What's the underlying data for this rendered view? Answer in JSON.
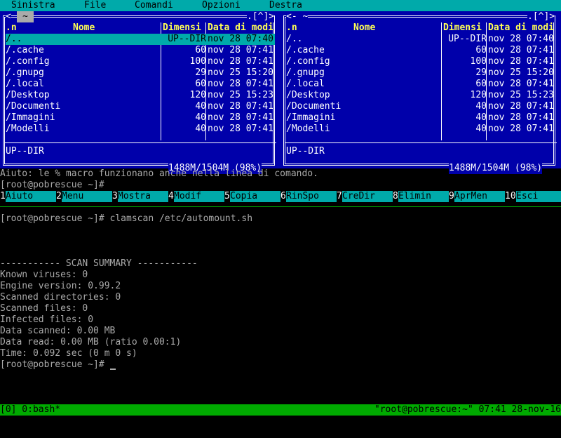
{
  "menubar": {
    "items": [
      "Sinistra",
      "File",
      "Comandi",
      "Opzioni",
      "Destra"
    ]
  },
  "left_panel": {
    "history_btn": "~",
    "caption_left": "<",
    "caption_right": ".[^]>",
    "headers": {
      "name": ".n",
      "name_title": "Nome",
      "size": "Dimensi",
      "date": "Data di modi"
    },
    "rows": [
      {
        "name": "/..",
        "size": "UP--DIR",
        "date": "nov 28 07:40",
        "selected": true
      },
      {
        "name": "/.cache",
        "size": "60",
        "date": "nov 28 07:41"
      },
      {
        "name": "/.config",
        "size": "100",
        "date": "nov 28 07:41"
      },
      {
        "name": "/.gnupg",
        "size": "29",
        "date": "nov 25 15:20"
      },
      {
        "name": "/.local",
        "size": "60",
        "date": "nov 28 07:41"
      },
      {
        "name": "/Desktop",
        "size": "120",
        "date": "nov 25 15:23"
      },
      {
        "name": "/Documenti",
        "size": "40",
        "date": "nov 28 07:41"
      },
      {
        "name": "/Immagini",
        "size": "40",
        "date": "nov 28 07:41"
      },
      {
        "name": "/Modelli",
        "size": "40",
        "date": "nov 28 07:41"
      }
    ],
    "status": "UP--DIR",
    "free": "1488M/1504M (98%)"
  },
  "right_panel": {
    "caption_left": "<- ~",
    "caption_right": ".[^]>",
    "headers": {
      "name": ".n",
      "name_title": "Nome",
      "size": "Dimensi",
      "date": "Data di modi"
    },
    "rows": [
      {
        "name": "/..",
        "size": "UP--DIR",
        "date": "nov 28 07:40"
      },
      {
        "name": "/.cache",
        "size": "60",
        "date": "nov 28 07:41"
      },
      {
        "name": "/.config",
        "size": "100",
        "date": "nov 28 07:41"
      },
      {
        "name": "/.gnupg",
        "size": "29",
        "date": "nov 25 15:20"
      },
      {
        "name": "/.local",
        "size": "60",
        "date": "nov 28 07:41"
      },
      {
        "name": "/Desktop",
        "size": "120",
        "date": "nov 25 15:23"
      },
      {
        "name": "/Documenti",
        "size": "40",
        "date": "nov 28 07:41"
      },
      {
        "name": "/Immagini",
        "size": "40",
        "date": "nov 28 07:41"
      },
      {
        "name": "/Modelli",
        "size": "40",
        "date": "nov 28 07:41"
      }
    ],
    "status": "UP--DIR",
    "free": "1488M/1504M (98%)"
  },
  "hint_line": "Aiuto: le % macro funzionano anche nella linea di comando.",
  "mc_prompt": "[root@pobrescue ~]#",
  "fkeys": [
    {
      "num": "1",
      "label": "Aiuto"
    },
    {
      "num": "2",
      "label": "Menu"
    },
    {
      "num": "3",
      "label": "Mostra"
    },
    {
      "num": "4",
      "label": "Modif"
    },
    {
      "num": "5",
      "label": "Copia"
    },
    {
      "num": "6",
      "label": "RinSpo"
    },
    {
      "num": "7",
      "label": "CreDir"
    },
    {
      "num": "8",
      "label": "Elimin"
    },
    {
      "num": "9",
      "label": "AprMen"
    },
    {
      "num": "10",
      "label": "Esci"
    }
  ],
  "terminal": {
    "command_line": "[root@pobrescue ~]# clamscan /etc/automount.sh",
    "summary_header": "----------- SCAN SUMMARY -----------",
    "lines": [
      "Known viruses: 0",
      "Engine version: 0.99.2",
      "Scanned directories: 0",
      "Scanned files: 0",
      "Infected files: 0",
      "Data scanned: 0.00 MB",
      "Data read: 0.00 MB (ratio 0.00:1)",
      "Time: 0.092 sec (0 m 0 s)"
    ],
    "final_prompt": "[root@pobrescue ~]# "
  },
  "tmux": {
    "left": "[0] 0:bash*",
    "right": "\"root@pobrescue:~\" 07:41 28-nov-16"
  },
  "colors": {
    "panel_bg": "#0000aa",
    "selection": "#00aaaa",
    "header_yellow": "#ffff55",
    "tmux_green": "#00aa00"
  }
}
